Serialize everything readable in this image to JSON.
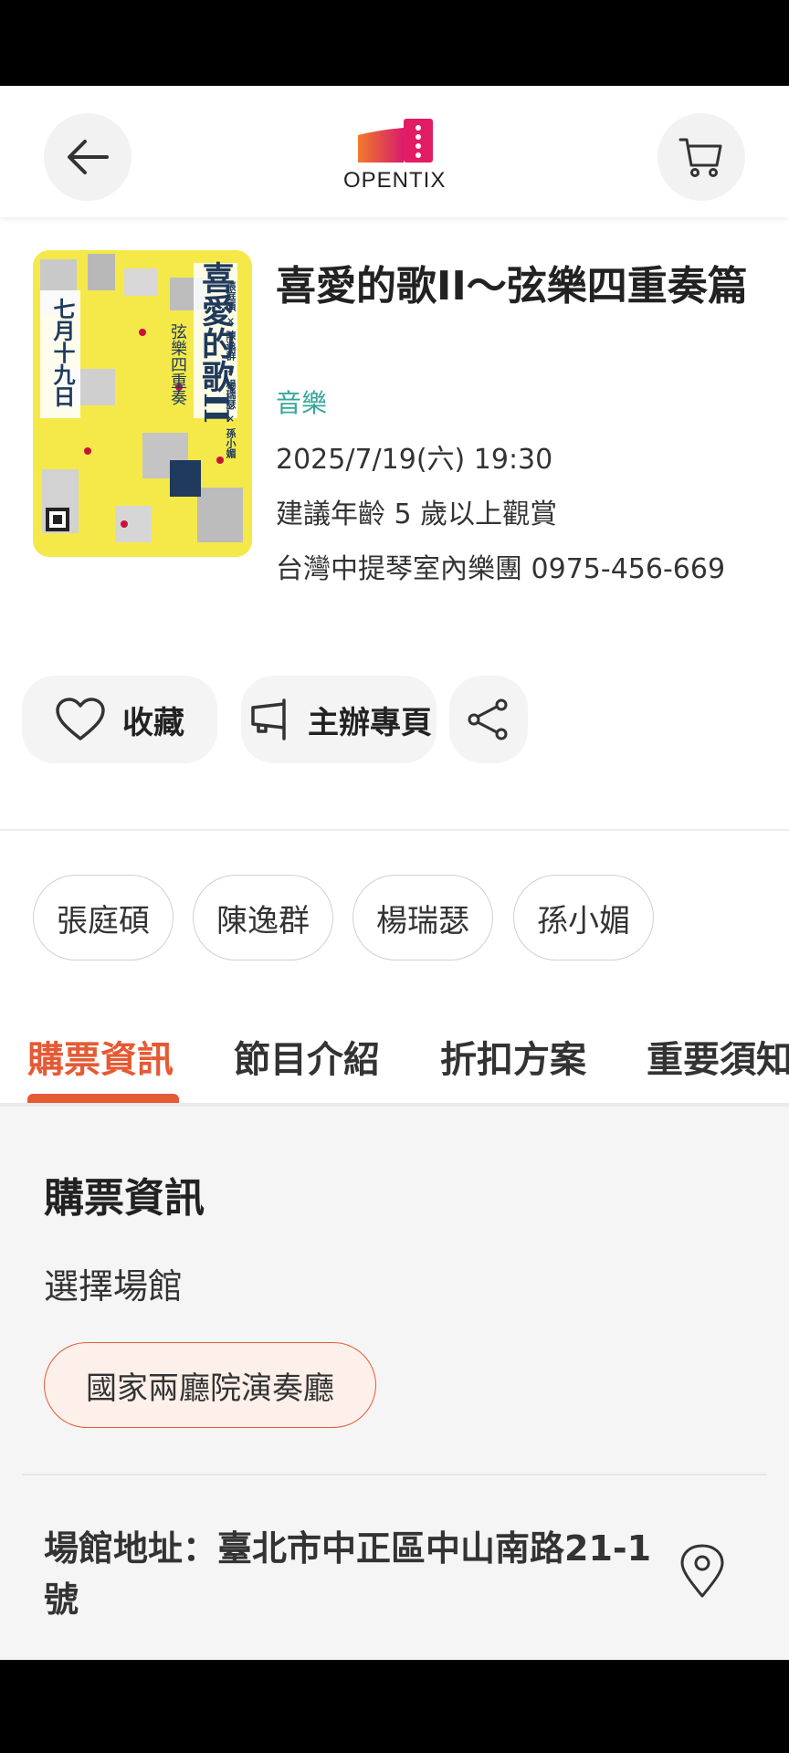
{
  "brand": {
    "name": "OPENTIX",
    "gradient_start": "#e85a2a",
    "gradient_end": "#d0206e"
  },
  "event": {
    "title": "喜愛的歌II～弦樂四重奏篇",
    "category": "音樂",
    "datetime": "2025/7/19(六) 19:30",
    "age": "建議年齡  5 歲以上觀賞",
    "organizer": "台灣中提琴室內樂團 0975-456-669"
  },
  "poster": {
    "big_title": "喜愛的歌II",
    "subtitle": "弦樂四重奏",
    "date": "七月十九日",
    "performers_line": "張庭碩 × 陳逸群 × 楊瑞瑟 × 孫小媚"
  },
  "actions": {
    "favorite": "收藏",
    "organizer_page": "主辦專頁"
  },
  "performers": [
    "張庭碩",
    "陳逸群",
    "楊瑞瑟",
    "孫小媚"
  ],
  "tabs": [
    {
      "label": "購票資訊",
      "active": true
    },
    {
      "label": "節目介紹",
      "active": false
    },
    {
      "label": "折扣方案",
      "active": false
    },
    {
      "label": "重要須知",
      "active": false
    }
  ],
  "ticket_info": {
    "heading": "購票資訊",
    "venue_label": "選擇場館",
    "venue": "國家兩廳院演奏廳",
    "address": "場館地址：臺北市中正區中山南路21-1號"
  },
  "colors": {
    "accent": "#e55a34",
    "category": "#35a79a"
  },
  "icons": {
    "back": "arrow-left-icon",
    "cart": "cart-icon",
    "favorite": "heart-icon",
    "organizer": "flag-icon",
    "share": "share-icon",
    "location": "map-pin-icon"
  }
}
